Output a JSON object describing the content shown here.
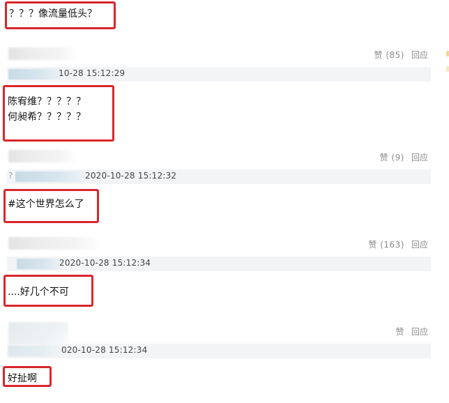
{
  "top_comment": {
    "text": "？？？像流量低头？"
  },
  "comments": [
    {
      "likes": "赞 (85)",
      "reply": "回应",
      "time": "10-28 15:12:29",
      "lines": [
        "陈宥维？？？？？",
        "何昶希？？？？？"
      ]
    },
    {
      "likes": "赞 (9)",
      "reply": "回应",
      "time_prefix": "?",
      "time": "2020-10-28 15:12:32",
      "lines": [
        "#这个世界怎么了"
      ]
    },
    {
      "likes": "赞 (163)",
      "reply": "回应",
      "time": "2020-10-28 15:12:34",
      "lines": [
        "....好几个不可"
      ]
    },
    {
      "likes": "赞",
      "reply": "回应",
      "time": "020-10-28 15:12:34",
      "lines": [
        "好扯啊"
      ]
    }
  ],
  "colors": {
    "annotation_red": "#d9262c",
    "meta_gray": "#8a8a8a",
    "time_bar_bg": "#f2f4f6"
  }
}
